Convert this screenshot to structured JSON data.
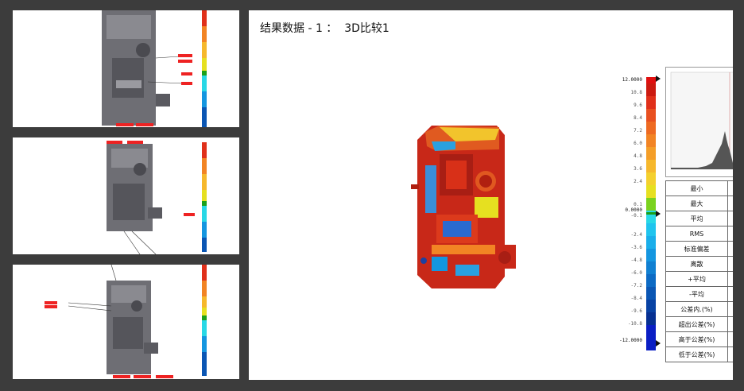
{
  "main": {
    "title": "结果数据 - 1 ：  3D比较1",
    "scale": {
      "labels": [
        "12.0000",
        "10.8",
        "9.6",
        "8.4",
        "7.2",
        "6.0",
        "4.8",
        "3.6",
        "2.4",
        "0.1",
        "0.0000",
        "-0.1",
        "-2.4",
        "-3.6",
        "-4.8",
        "-6.0",
        "-7.2",
        "-8.4",
        "-9.6",
        "-10.8",
        "-12.0000"
      ],
      "colors": [
        "#cc1a10",
        "#e0301a",
        "#e85020",
        "#ee6a22",
        "#f28424",
        "#f49e28",
        "#f6b82c",
        "#f4d02e",
        "#e6e020",
        "#7ad21e",
        "#28d8e6",
        "#20c4ee",
        "#1aaeea",
        "#1496e0",
        "#1080d2",
        "#0c6ac4",
        "#0a56b4",
        "#0842a4",
        "#063092",
        "#0a1ec4"
      ],
      "max_marker_color": "#e01010",
      "min_marker_color": "#0a1ec4",
      "zero_color": "#1aa01a"
    },
    "stats_rows": [
      "最小",
      "最大",
      "平均",
      "RMS",
      "标准偏差",
      "离散",
      "+平均",
      "-平均",
      "公差内.(%)",
      "超出公差(%)",
      "高于公差(%)",
      "低于公差(%)"
    ]
  },
  "thumbnails": [
    {
      "name": "thumbnail-view-1"
    },
    {
      "name": "thumbnail-view-2"
    },
    {
      "name": "thumbnail-view-3"
    }
  ]
}
